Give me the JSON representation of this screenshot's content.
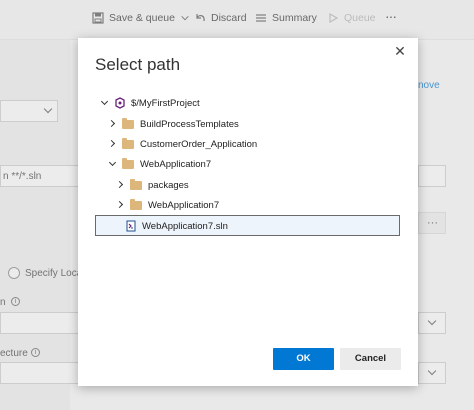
{
  "toolbar": {
    "save_queue": "Save & queue",
    "discard": "Discard",
    "summary": "Summary",
    "queue": "Queue",
    "more": "···"
  },
  "background": {
    "link_partial": "nove",
    "field_text": "n **/*.sln",
    "radio_label": "Specify Loca",
    "label_n": "n",
    "label_architecture": "ecture",
    "ellipsis_button": "···"
  },
  "dialog": {
    "title": "Select path",
    "close_glyph": "✕",
    "tree": [
      {
        "label": "$/MyFirstProject",
        "expanded": true,
        "icon": "project-icon"
      },
      {
        "label": "BuildProcessTemplates",
        "expanded": false,
        "icon": "folder-icon"
      },
      {
        "label": "CustomerOrder_Application",
        "expanded": false,
        "icon": "folder-icon"
      },
      {
        "label": "WebApplication7",
        "expanded": true,
        "icon": "folder-icon"
      },
      {
        "label": "packages",
        "expanded": false,
        "icon": "folder-icon"
      },
      {
        "label": "WebApplication7",
        "expanded": false,
        "icon": "folder-icon"
      },
      {
        "label": "WebApplication7.sln",
        "selected": true,
        "icon": "solution-file-icon"
      }
    ],
    "ok_label": "OK",
    "cancel_label": "Cancel"
  },
  "colors": {
    "accent": "#0078d4",
    "folder": "#dcb67a",
    "project_icon": "#68217a"
  }
}
